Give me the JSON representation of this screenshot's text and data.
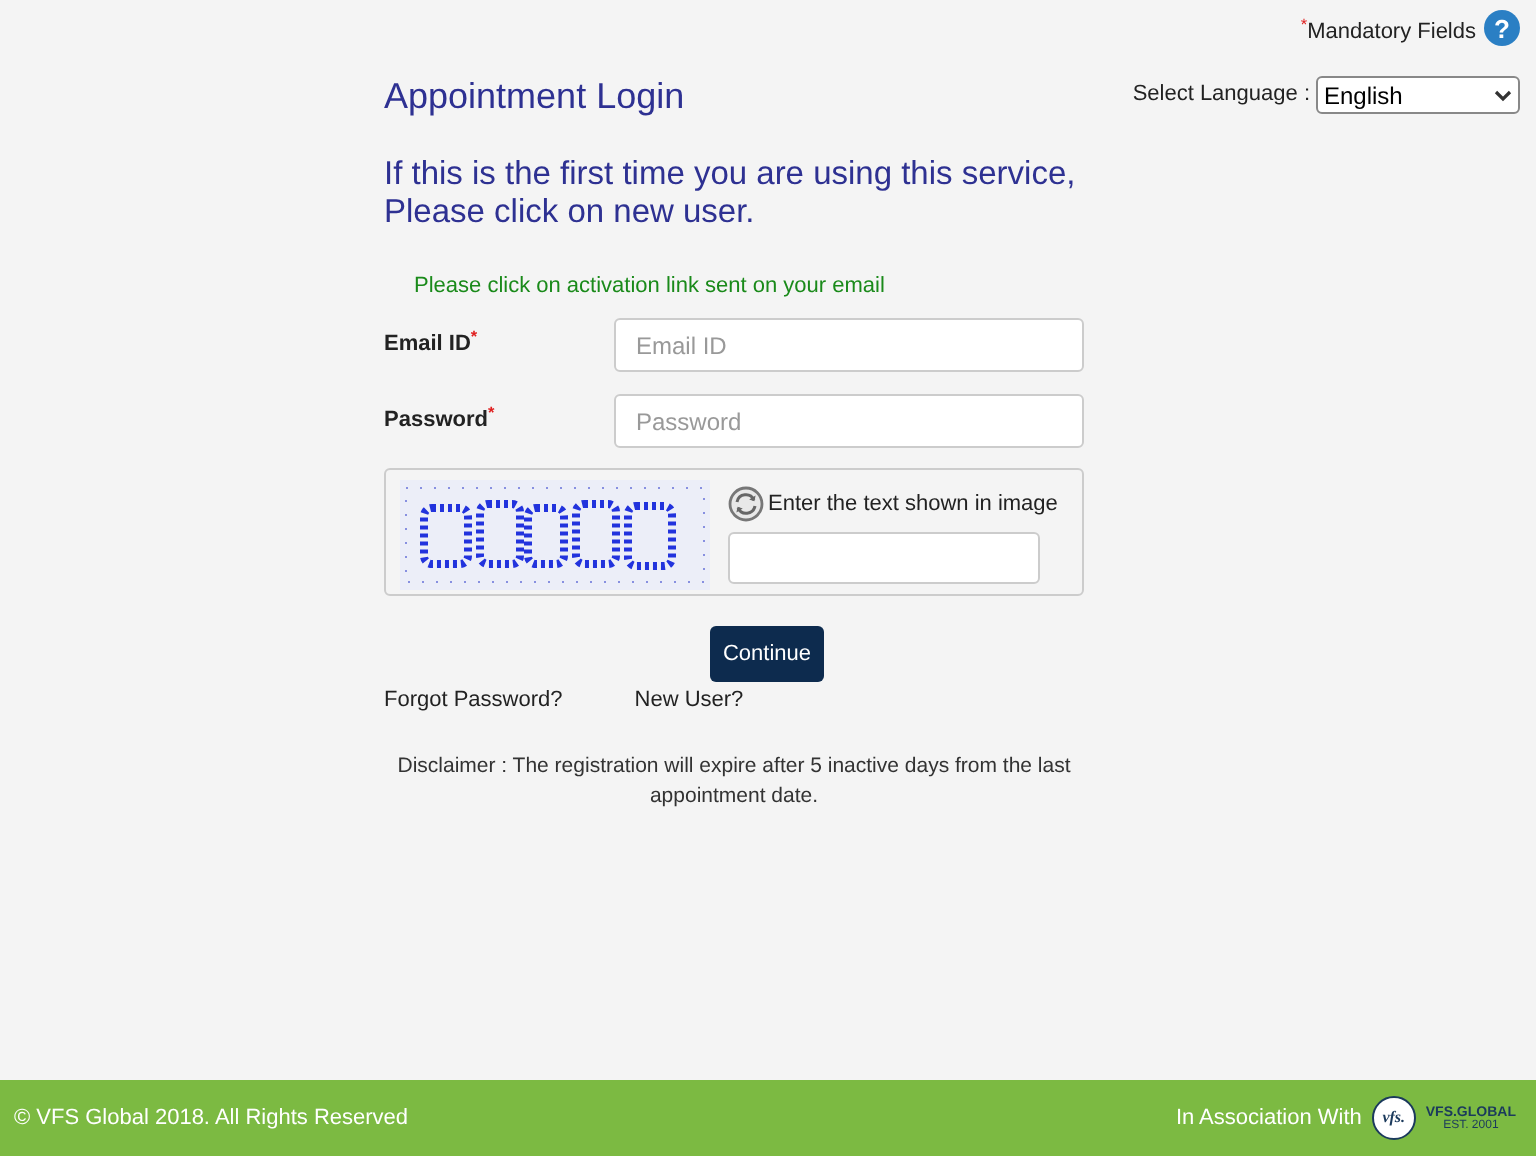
{
  "header": {
    "mandatory_mark": "*",
    "mandatory_label": "Mandatory Fields",
    "help_icon": "?",
    "language_label": "Select Language :",
    "language_value": "English"
  },
  "title": "Appointment Login",
  "intro": [
    "If this is the first time you are using this service,",
    "Please click on new user."
  ],
  "notice": "Please click on activation link sent on your email",
  "fields": [
    {
      "label": "Email ID",
      "required_mark": "*",
      "placeholder": "Email ID"
    },
    {
      "label": "Password",
      "required_mark": "*",
      "placeholder": "Password"
    }
  ],
  "captcha": {
    "prompt": "Enter the text shown in image"
  },
  "continue_button": "Continue",
  "links": [
    "Forgot Password?",
    "New User?"
  ],
  "disclaimer": "Disclaimer : The registration will expire after 5 inactive days from the last appointment date.",
  "footer": {
    "copyright": "© VFS Global 2018. All Rights Reserved",
    "association": "In Association With",
    "logo_mark": "vfs.",
    "logo_name": "VFS.GLOBAL",
    "logo_est": "EST. 2001"
  }
}
